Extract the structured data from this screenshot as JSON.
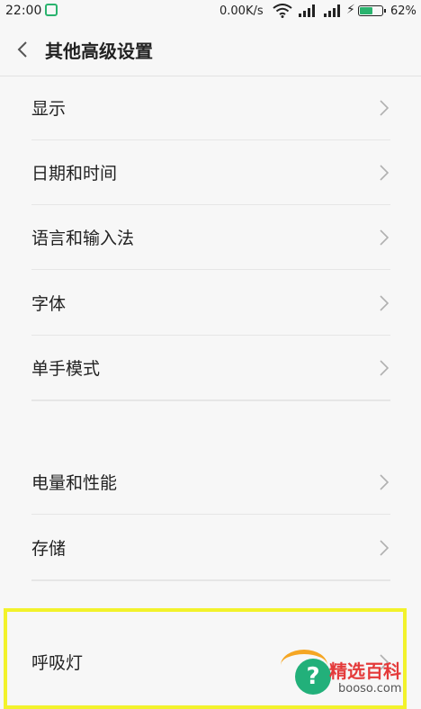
{
  "status_bar": {
    "time": "22:00",
    "net_speed": "0.00K/s",
    "charging_icon": "⚡",
    "battery_percent": "62%",
    "battery_level": 0.62
  },
  "header": {
    "title": "其他高级设置"
  },
  "settings": [
    {
      "label": "显示"
    },
    {
      "label": "日期和时间"
    },
    {
      "label": "语言和输入法"
    },
    {
      "label": "字体"
    },
    {
      "label": "单手模式"
    },
    {
      "label": "电量和性能"
    },
    {
      "label": "存储"
    },
    {
      "label": "呼吸灯"
    }
  ],
  "watermark": {
    "brand": "精选百科",
    "domain": "booso.com",
    "icon": "?"
  },
  "colors": {
    "accent_green": "#2ab36e",
    "highlight_yellow": "#f2f22b",
    "watermark_red": "#e43a3a"
  }
}
